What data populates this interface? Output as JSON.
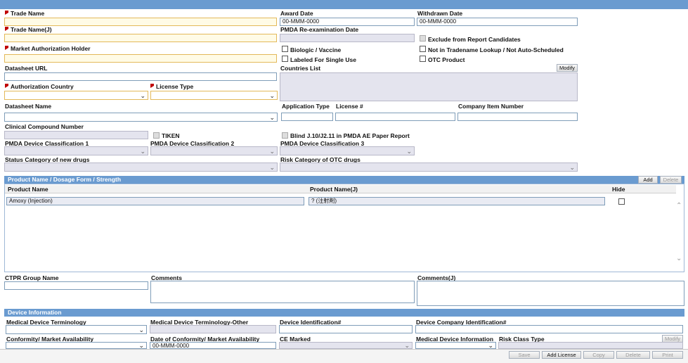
{
  "general": {
    "trade_name": "Trade Name",
    "trade_name_j": "Trade Name(J)",
    "mah": "Market Authorization Holder",
    "datasheet_url": "Datasheet URL",
    "auth_country": "Authorization Country",
    "license_type": "License Type",
    "datasheet_name": "Datasheet Name",
    "clinical_compound": "Clinical Compound Number",
    "tiken": "TIKEN",
    "pmda1": "PMDA Device Classification 1",
    "pmda2": "PMDA Device Classification 2",
    "pmda3": "PMDA Device Classification 3",
    "status_category": "Status Category of new drugs",
    "risk_category": "Risk Category of OTC drugs",
    "award_date": "Award Date",
    "award_date_value": "00-MMM-0000",
    "withdrawn_date": "Withdrawn Date",
    "withdrawn_date_value": "00-MMM-0000",
    "pmda_reexam": "PMDA Re-examination Date",
    "exclude": "Exclude from Report Candidates",
    "biologic": "Biologic / Vaccine",
    "not_tradename": "Not in Tradename Lookup / Not Auto-Scheduled",
    "single_use": "Labeled For Single Use",
    "otc": "OTC Product",
    "countries_list": "Countries List",
    "modify": "Modify",
    "application_type": "Application Type",
    "license_no": "License #",
    "company_item": "Company Item Number",
    "blind": "Blind J.10/J2.11 in PMDA AE Paper Report"
  },
  "products": {
    "section_title": "Product Name / Dosage Form / Strength",
    "add": "Add",
    "delete": "Delete",
    "col_name": "Product Name",
    "col_name_j": "Product Name(J)",
    "col_hide": "Hide",
    "rows": [
      {
        "name": "Amoxy (Injection)",
        "name_j": "? (注射剤)"
      }
    ]
  },
  "comments": {
    "ctpr": "CTPR Group Name",
    "comments": "Comments",
    "comments_j": "Comments(J)"
  },
  "device": {
    "section_title": "Device Information",
    "mdt": "Medical Device Terminology",
    "mdt_other": "Medical Device Terminology-Other",
    "device_id": "Device Identification#",
    "device_company_id": "Device Company Identification#",
    "conformity": "Conformity/ Market Availability",
    "date_conformity": "Date of Conformity/ Market Availability",
    "date_conformity_value": "00-MMM-0000",
    "ce_marked": "CE Marked",
    "mdi": "Medical Device Information",
    "risk_class": "Risk Class Type",
    "modify": "Modify"
  },
  "footer": {
    "save": "Save",
    "add_license": "Add License",
    "copy": "Copy",
    "delete": "Delete",
    "print": "Print"
  },
  "colors": {
    "header_blue": "#6a9bd0",
    "required_flag": "#c00000",
    "required_field_bg": "#fffbe6"
  }
}
